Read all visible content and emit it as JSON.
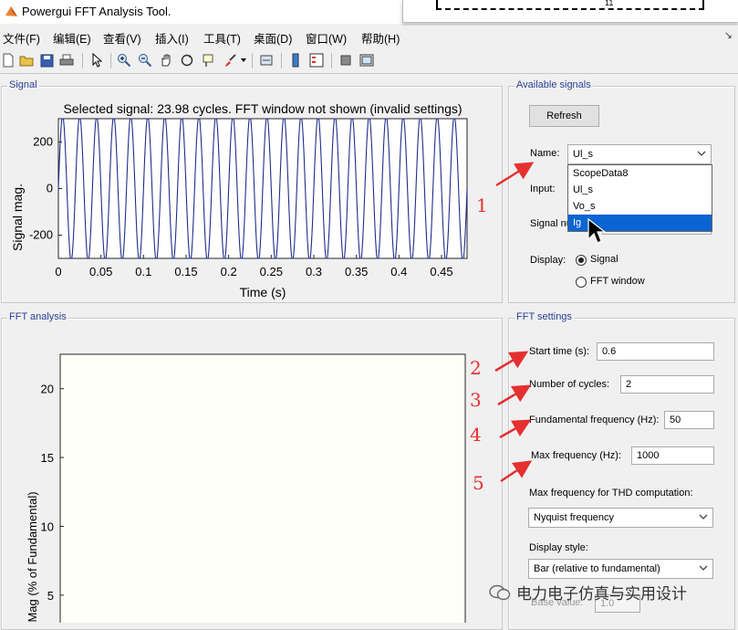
{
  "window": {
    "title": "Powergui FFT Analysis Tool."
  },
  "popup": {
    "tick_label": "11"
  },
  "menubar": {
    "items": [
      "文件(F)",
      "编辑(E)",
      "查看(V)",
      "插入(I)",
      "工具(T)",
      "桌面(D)",
      "窗口(W)",
      "帮助(H)"
    ],
    "pin": "↘"
  },
  "toolbar": {
    "buttons": [
      "new-icon",
      "open-icon",
      "save-icon",
      "print-icon",
      "pointer-icon",
      "zoom-in-icon",
      "zoom-out-icon",
      "pan-icon",
      "rotate-icon",
      "datacursor-icon",
      "brush-icon",
      "link-icon",
      "colorbar-icon",
      "legend-icon",
      "hide-plot-tools-icon",
      "show-plot-tools-icon"
    ]
  },
  "signal_panel": {
    "title": "Signal",
    "plot_title": "Selected signal: 23.98 cycles. FFT window not shown (invalid settings)",
    "ylabel": "Signal mag.",
    "xlabel": "Time (s)"
  },
  "chart_data": [
    {
      "type": "line",
      "title": "Selected signal: 23.98 cycles. FFT window not shown (invalid settings)",
      "xlabel": "Time (s)",
      "ylabel": "Signal mag.",
      "xlim": [
        0,
        0.48
      ],
      "ylim": [
        -300,
        300
      ],
      "xticks": [
        "0",
        "0.05",
        "0.1",
        "0.15",
        "0.2",
        "0.25",
        "0.3",
        "0.35",
        "0.4",
        "0.45"
      ],
      "yticks": [
        "200",
        "0",
        "-200"
      ],
      "series": [
        {
          "frequency_hz": 50,
          "amplitude": 310,
          "color": "#1f2e8a"
        }
      ]
    },
    {
      "type": "bar",
      "xlabel": "",
      "ylabel": "Mag (% of Fundamental)",
      "ylim": [
        3,
        22.5
      ],
      "yticks": [
        "20",
        "15",
        "10",
        "5"
      ],
      "values": []
    }
  ],
  "available_signals": {
    "title": "Available signals",
    "refresh_label": "Refresh",
    "name_label": "Name:",
    "name_value": "Ul_s",
    "input_label": "Input:",
    "signal_number_label": "Signal nu",
    "display_label": "Display:",
    "display_options": [
      "Signal",
      "FFT window"
    ],
    "display_selected": "Signal",
    "dropdown_options": [
      "ScopeData8",
      "Ul_s",
      "Vo_s",
      "Ig"
    ],
    "dropdown_highlighted": "Ig"
  },
  "fft_panel": {
    "title": "FFT analysis"
  },
  "fft_settings": {
    "title": "FFT settings",
    "start_time_label": "Start time (s):",
    "start_time_value": "0.6",
    "cycles_label": "Number of cycles:",
    "cycles_value": "2",
    "fund_freq_label": "Fundamental frequency (Hz):",
    "fund_freq_value": "50",
    "max_freq_label": "Max frequency (Hz):",
    "max_freq_value": "1000",
    "thd_label": "Max frequency for THD computation:",
    "thd_value": "Nyquist frequency",
    "display_style_label": "Display style:",
    "display_style_value": "Bar (relative to fundamental)",
    "base_value_label": "Base value:",
    "base_value": "1.0"
  },
  "annotations": [
    "1",
    "2",
    "3",
    "4",
    "5"
  ],
  "watermark": {
    "text": "电力电子仿真与实用设计"
  },
  "colors": {
    "accent_title": "#2a3f93",
    "signal_line": "#1f2e8a",
    "highlight": "#0a64d2",
    "annotation": "#e53030"
  }
}
